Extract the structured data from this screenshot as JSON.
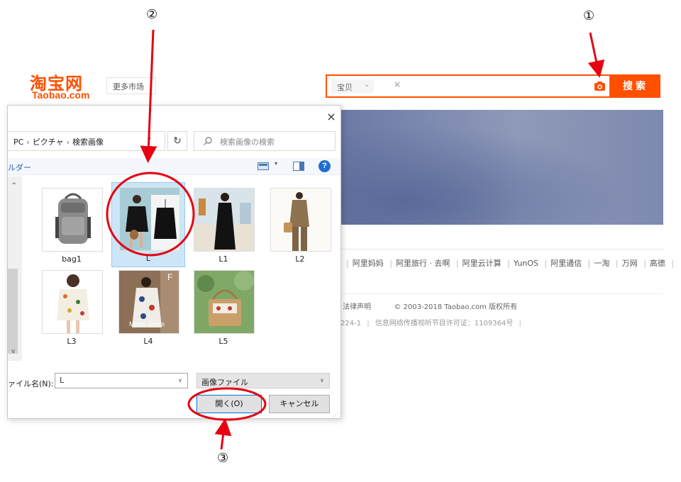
{
  "taobao": {
    "logo_cn": "淘宝网",
    "logo_en": "Taobao.com",
    "market_dropdown": "更多市场",
    "search": {
      "type_label": "宝贝",
      "clear": "×",
      "placeholder": "",
      "button_label": "搜索"
    },
    "footer": {
      "links": [
        "阿里妈妈",
        "阿里旅行 · 去啊",
        "阿里云计算",
        "YunOS",
        "阿里通信",
        "一淘",
        "万网",
        "高德"
      ],
      "legal_link": "法律声明",
      "copyright": "© 2003-2018 Taobao.com 版权所有",
      "icp_partial": "224-1",
      "license": "信息网络传播视听节目许可证：1109364号"
    },
    "colors": {
      "brand": "#ff5000",
      "banner": "#7d89ae"
    }
  },
  "dialog": {
    "close": "×",
    "breadcrumb": [
      "PC",
      "ピクチャ",
      "検索画像"
    ],
    "search_placeholder": "検索画像の検索",
    "folder_label": "ルダー",
    "help": "?",
    "files": [
      {
        "name": "bag1",
        "selected": false
      },
      {
        "name": "L",
        "selected": true
      },
      {
        "name": "L1",
        "selected": false
      },
      {
        "name": "L2",
        "selected": false
      },
      {
        "name": "L3",
        "selected": false
      },
      {
        "name": "L4",
        "selected": false
      },
      {
        "name": "L5",
        "selected": false
      }
    ],
    "thumb_text": {
      "L4_caption": "Maxie Dress",
      "L4_letter": "F"
    },
    "filename_label": "ァイル名(N):",
    "filename_value": "L",
    "filetype_value": "画像ファイル",
    "open_button": "開く(O)",
    "cancel_button": "キャンセル",
    "colors": {
      "selection": "#cde6f7",
      "accent": "#0078d7"
    }
  },
  "annotations": {
    "step1": "①",
    "step2": "②",
    "step3": "③",
    "color": "#e60012"
  }
}
